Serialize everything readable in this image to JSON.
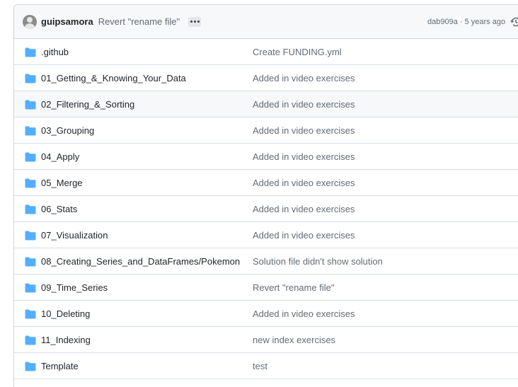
{
  "commit": {
    "author": "guipsamora",
    "message": "Revert \"rename file\"",
    "meta": "dab909a · 5 years ago"
  },
  "icons": {
    "folder": "folder-icon",
    "history": "history-icon",
    "ellipsis": "ellipsis-icon",
    "avatar": "avatar"
  },
  "colors": {
    "folder": "#54aeff",
    "link": "#1f2328",
    "muted": "#636c76",
    "header_bg": "#f6f8fa"
  },
  "files": [
    {
      "name": ".github",
      "message": "Create FUNDING.yml"
    },
    {
      "name": "01_Getting_&_Knowing_Your_Data",
      "message": "Added in video exercises"
    },
    {
      "name": "02_Filtering_&_Sorting",
      "message": "Added in video exercises"
    },
    {
      "name": "03_Grouping",
      "message": "Added in video exercises"
    },
    {
      "name": "04_Apply",
      "message": "Added in video exercises"
    },
    {
      "name": "05_Merge",
      "message": "Added in video exercises"
    },
    {
      "name": "06_Stats",
      "message": "Added in video exercises"
    },
    {
      "name": "07_Visualization",
      "message": "Added in video exercises"
    },
    {
      "name": "08_Creating_Series_and_DataFrames/Pokemon",
      "message": "Solution file didn't show solution"
    },
    {
      "name": "09_Time_Series",
      "message": "Revert \"rename file\""
    },
    {
      "name": "10_Deleting",
      "message": "Added in video exercises"
    },
    {
      "name": "11_Indexing",
      "message": "new index exercises"
    },
    {
      "name": "Template",
      "message": "test"
    }
  ]
}
